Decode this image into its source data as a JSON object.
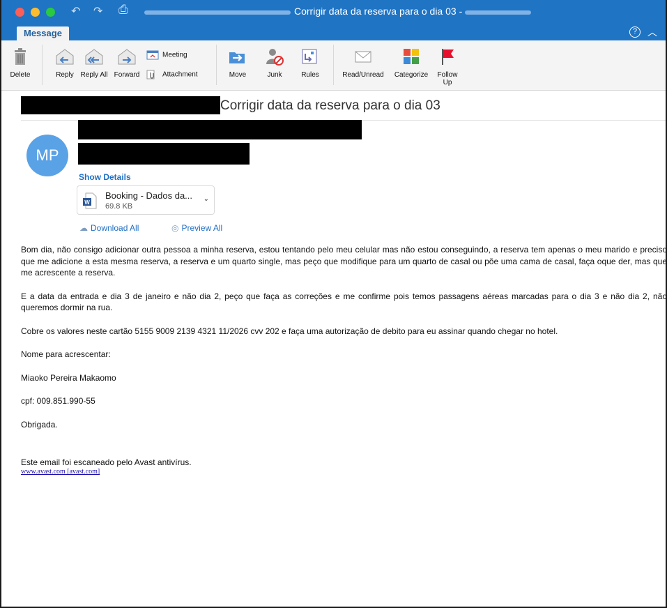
{
  "window": {
    "title": "Corrigir data da reserva para o dia 03 -"
  },
  "tabs": [
    {
      "label": "Message",
      "active": true
    }
  ],
  "help_icon": "?",
  "ribbon": {
    "delete": "Delete",
    "reply": "Reply",
    "reply_all": "Reply All",
    "forward": "Forward",
    "meeting": "Meeting",
    "attachment": "Attachment",
    "move": "Move",
    "junk": "Junk",
    "rules": "Rules",
    "read_unread": "Read/Unread",
    "categorize": "Categorize",
    "follow_up": "Follow Up"
  },
  "email": {
    "subject": "Corrigir data da reserva para o dia 03",
    "avatar_initials": "MP",
    "show_details": "Show Details",
    "attachment": {
      "name": "Booking - Dados da...",
      "size": "69.8 KB"
    },
    "download_all": "Download All",
    "preview_all": "Preview All",
    "body": {
      "p1": "Bom dia, não consigo adicionar outra pessoa a minha reserva, estou tentando pelo meu celular mas não estou conseguindo, a reserva tem apenas o meu marido e preciso que me adicione a esta mesma reserva, a reserva e um quarto single, mas peço que modifique para um quarto de casal ou põe uma cama de casal, faça oque der, mas que me acrescente a reserva.",
      "p2": "E a data da entrada e dia 3 de janeiro e não dia 2, peço que faça as correções e me confirme pois temos passagens aéreas marcadas para o dia 3 e não dia 2, não queremos dormir na rua.",
      "p3": "Cobre os valores neste cartão 5155 9009 2139 4321 11/2026 cvv 202 e faça uma autorização de debito para eu assinar quando chegar no hotel.",
      "p4": "Nome para acrescentar:",
      "p5": "Miaoko Pereira Makaomo",
      "p6": "cpf: 009.851.990-55",
      "p7": "Obrigada."
    },
    "footer": "Este email foi escaneado pelo Avast antivírus.",
    "footer_link": "www.avast.com [avast.com]"
  },
  "colors": {
    "title_bar": "#1f74c4",
    "link": "#1f6fc5",
    "avatar": "#5aa2e6",
    "flag": "#e8112d"
  },
  "icons": [
    "undo-icon",
    "redo-icon",
    "quick-access-icon",
    "trash-icon",
    "reply-icon",
    "reply-all-icon",
    "forward-icon",
    "meeting-icon",
    "paperclip-icon",
    "move-icon",
    "junk-icon",
    "rules-icon",
    "envelope-icon",
    "categorize-icon",
    "flag-icon",
    "word-doc-icon",
    "cloud-download-icon",
    "eye-icon",
    "help-icon",
    "chevron-up-icon"
  ]
}
